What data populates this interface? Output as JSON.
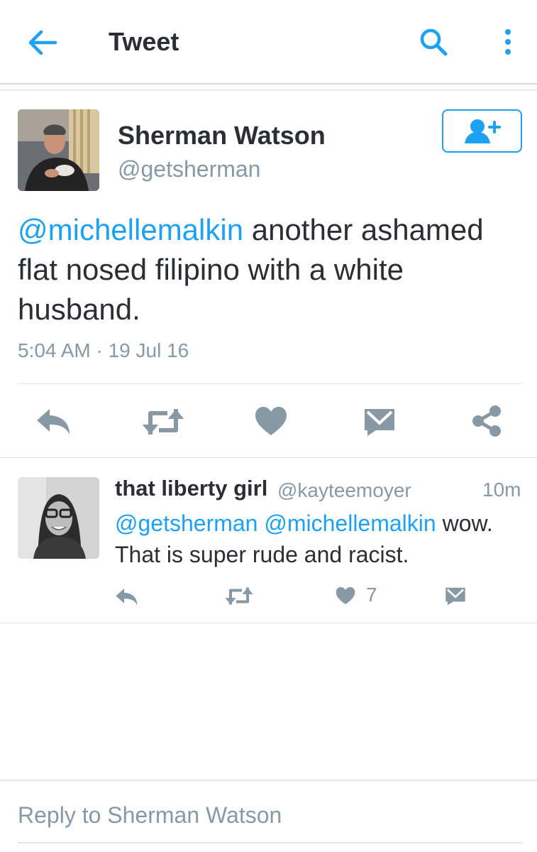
{
  "header": {
    "title": "Tweet",
    "back_icon": "arrow-left-icon",
    "search_icon": "search-icon",
    "more_icon": "more-vertical-icon"
  },
  "tweet": {
    "author_name": "Sherman Watson",
    "author_handle": "@getsherman",
    "mention": "@michellemalkin",
    "text": " another ashamed flat nosed filipino with a white husband.",
    "timestamp": "5:04 AM · 19 Jul 16",
    "follow_icon": "add-user-icon"
  },
  "reply": {
    "author_name": "that liberty girl",
    "author_handle": "@kayteemoyer",
    "time": "10m",
    "mention1": "@getsherman",
    "mention2": "@michellemalkin",
    "text": " wow. That is super rude and racist.",
    "like_count": "7"
  },
  "composer": {
    "placeholder": "Reply to Sherman Watson"
  },
  "colors": {
    "accent": "#1da1f2",
    "icon_gray": "#8899a6",
    "text": "#292f33"
  }
}
